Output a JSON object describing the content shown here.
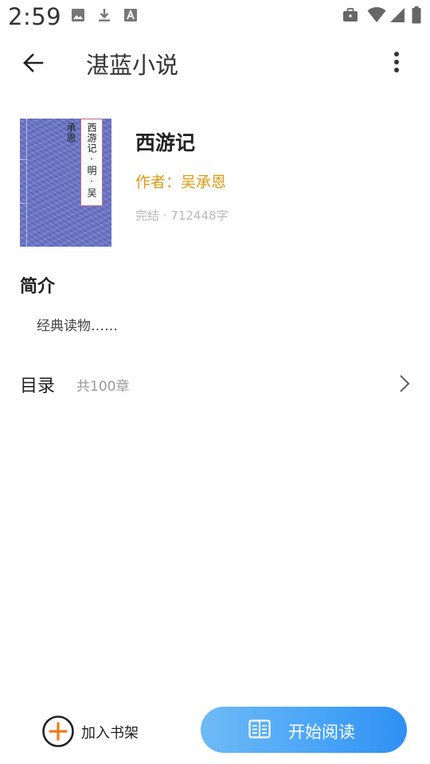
{
  "status_bar": {
    "time": "2:59",
    "left_icons": [
      "image-icon",
      "download-icon",
      "text-a-icon"
    ],
    "right_icons": [
      "briefcase-icon",
      "wifi-icon",
      "signal-icon",
      "battery-icon"
    ]
  },
  "app_bar": {
    "title": "湛蓝小说",
    "back_icon": "arrow-left-icon",
    "more_icon": "more-vertical-icon"
  },
  "book": {
    "cover_label": "西游记·明·吴承恩",
    "title": "西游记",
    "author": "作者：吴承恩",
    "meta": "完结 · 712448字"
  },
  "intro": {
    "heading": "简介",
    "text": "经典读物……"
  },
  "toc": {
    "label": "目录",
    "count": "共100章",
    "chevron_icon": "chevron-right-icon"
  },
  "bottom_bar": {
    "add_shelf_label": "加入书架",
    "start_read_label": "开始阅读"
  },
  "colors": {
    "author": "#e09a17",
    "button_gradient_start": "#6fbaf6",
    "button_gradient_end": "#2f90f3",
    "add_icon_accent": "#f07a1c",
    "cover": "#6a75c9"
  }
}
